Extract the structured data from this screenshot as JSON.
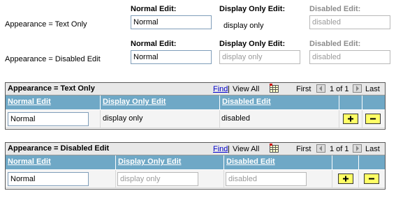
{
  "top": {
    "row1": {
      "label": "Appearance = Text Only",
      "normal_edit_label": "Normal Edit:",
      "display_only_label": "Display Only Edit:",
      "disabled_label": "Disabled Edit:",
      "normal_value": "Normal",
      "display_only_value": "display only",
      "disabled_value": "disabled"
    },
    "row2": {
      "label": "Appearance = Disabled Edit",
      "normal_edit_label": "Normal Edit:",
      "display_only_label": "Display Only Edit:",
      "disabled_label": "Disabled Edit:",
      "normal_value": "Normal",
      "display_only_value": "display only",
      "disabled_value": "disabled"
    }
  },
  "grids": [
    {
      "title": "Appearance = Text Only",
      "find": "Find",
      "separator": "|",
      "view_all": "View All",
      "first": "First",
      "page_info": "1 of 1",
      "last": "Last",
      "columns": [
        "Normal Edit",
        "Display Only Edit",
        "Disabled Edit"
      ],
      "row": {
        "normal": "Normal",
        "display_only": "display only",
        "disabled": "disabled"
      }
    },
    {
      "title": "Appearance = Disabled Edit",
      "find": "Find",
      "separator": "|",
      "view_all": "View All",
      "first": "First",
      "page_info": "1 of 1",
      "last": "Last",
      "columns": [
        "Normal Edit",
        "Display Only Edit",
        "Disabled Edit"
      ],
      "row": {
        "normal": "Normal",
        "display_only": "display only",
        "disabled": "disabled"
      }
    }
  ],
  "colors": {
    "header_bg": "#6fa8c6",
    "title_bar_bg": "#e8e8e8",
    "button_bg": "#ffff66",
    "link": "#0000cc"
  },
  "icons": {
    "grid_icon": "spreadsheet-icon",
    "prev": "arrow-left-icon",
    "next": "arrow-right-icon",
    "add": "plus-icon",
    "delete": "minus-icon"
  }
}
